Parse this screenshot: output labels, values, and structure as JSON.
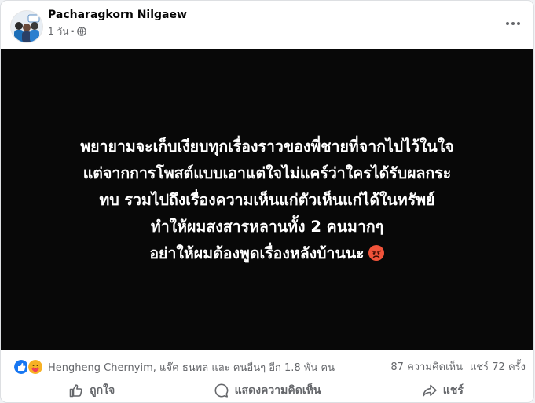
{
  "post": {
    "author": "Pacharagkorn Nilgaew",
    "timestamp": "1 วัน",
    "separator": "·",
    "privacy_icon": "globe-icon",
    "more_icon": "more-dots-icon",
    "background_color": "#080808",
    "text_color": "#ffffff",
    "lines": [
      "พยายามจะเก็บเงียบทุกเรื่องราวของพี่ชายที่จากไปไว้ในใจ",
      "แต่จากการโพสต์แบบเอาแต่ใจไม่แคร์ว่าใครได้รับผลกระ",
      "ทบ รวมไปถึงเรื่องความเห็นแก่ตัวเห็นแก่ได้ในทรัพย์",
      "ทำให้ผมสงสารหลานทั้ง 2 คนมากๆ",
      "อย่าให้ผมต้องพูดเรื่องหลังบ้านนะ"
    ],
    "trailing_emoji": "angry-face-icon"
  },
  "stats": {
    "reaction_icons": [
      "like-reaction-icon",
      "care-reaction-icon"
    ],
    "reactors": "Hengheng Chernyim, แจ๊ค ธนพล และ คนอื่นๆ อีก 1.8 พัน คน",
    "comments": "87 ความคิดเห็น",
    "shares": "แชร์ 72 ครั้ง"
  },
  "actions": {
    "like": "ถูกใจ",
    "comment": "แสดงความคิดเห็น",
    "share": "แชร์"
  },
  "colors": {
    "accent": "#1877f2",
    "secondary_text": "#65676b",
    "angry": "#f0533a"
  }
}
